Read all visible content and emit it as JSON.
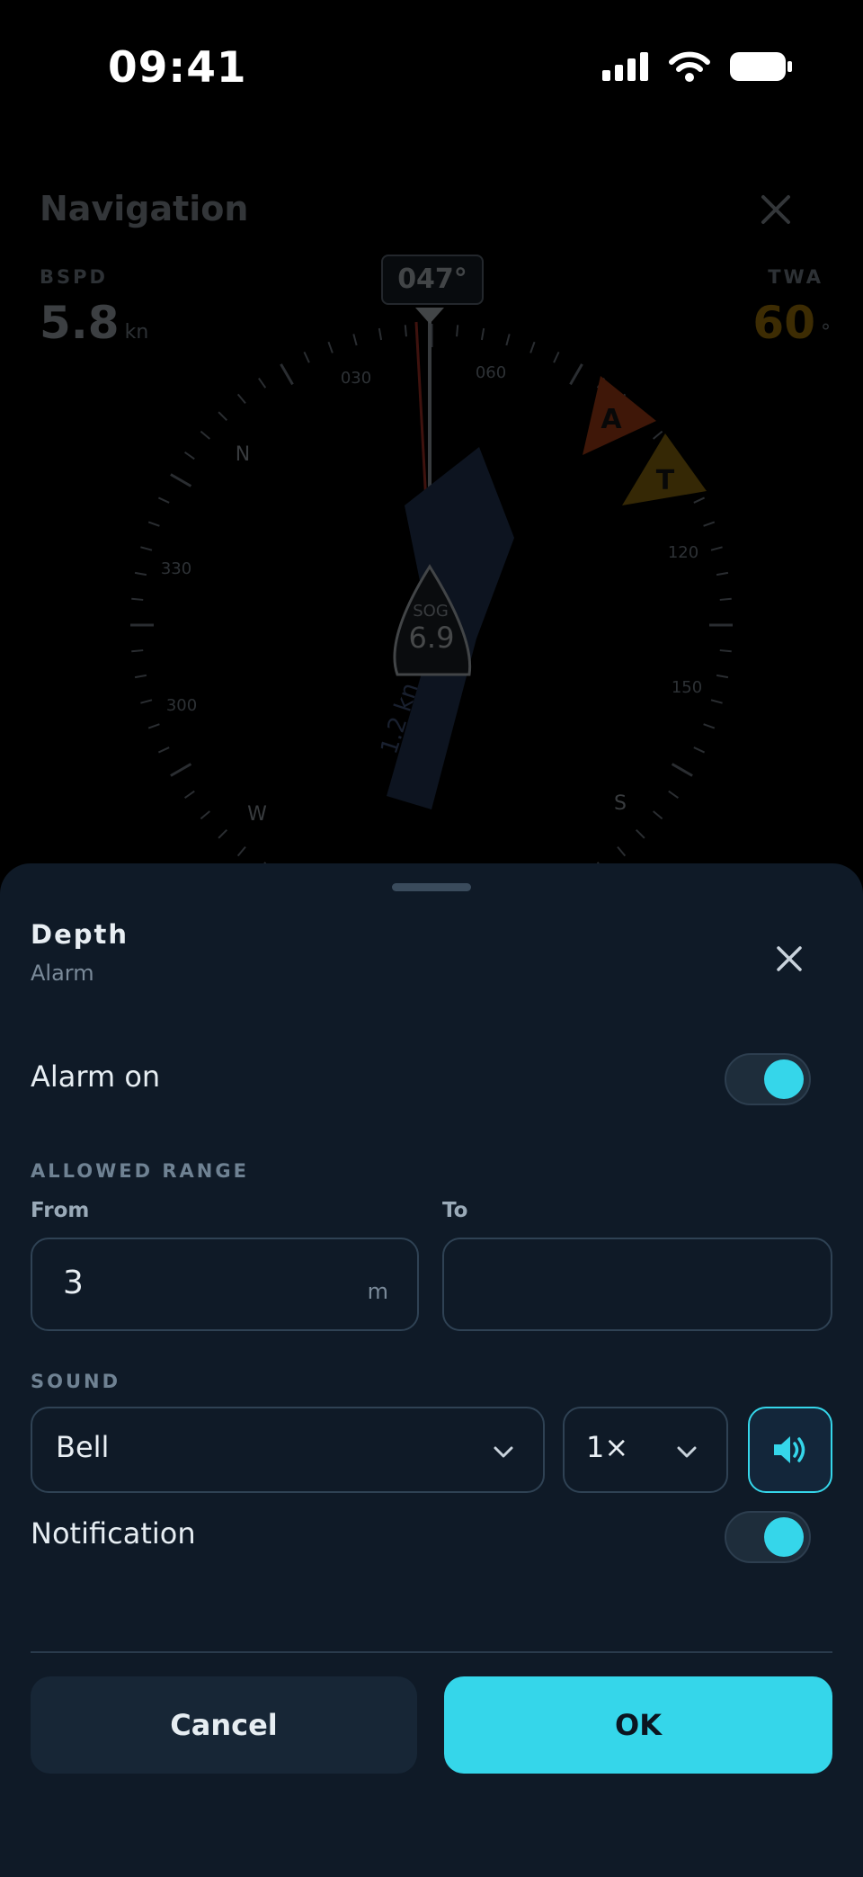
{
  "status": {
    "time": "09:41"
  },
  "navigation": {
    "title": "Navigation",
    "bspd_label": "BSPD",
    "bspd_value": "5.8",
    "bspd_unit": "kn",
    "twa_label": "TWA",
    "twa_value": "60",
    "twa_unit": "°",
    "heading": "047°",
    "compass_labels": [
      "N",
      "030",
      "060",
      "120",
      "150",
      "S",
      "W",
      "300",
      "330"
    ],
    "sog_label": "SOG",
    "sog_value": "6.9",
    "current_label": "1.2 kn",
    "marker_apparent": "A",
    "marker_true": "T"
  },
  "sheet": {
    "title": "Depth",
    "subtitle": "Alarm",
    "alarm_label": "Alarm on",
    "alarm_on": true,
    "range_section": "ALLOWED RANGE",
    "from_label": "From",
    "from_value": "3",
    "from_unit": "m",
    "to_label": "To",
    "to_value": "",
    "sound_section": "SOUND",
    "sound_value": "Bell",
    "repeat_value": "1×",
    "notification_label": "Notification",
    "notification_on": true,
    "cancel_label": "Cancel",
    "ok_label": "OK"
  },
  "colors": {
    "accent": "#35d6ea",
    "sheet_bg": "#0f1a27",
    "twa_color": "#b8860b",
    "apparent_marker": "#c0461a",
    "true_marker": "#a07a10"
  }
}
